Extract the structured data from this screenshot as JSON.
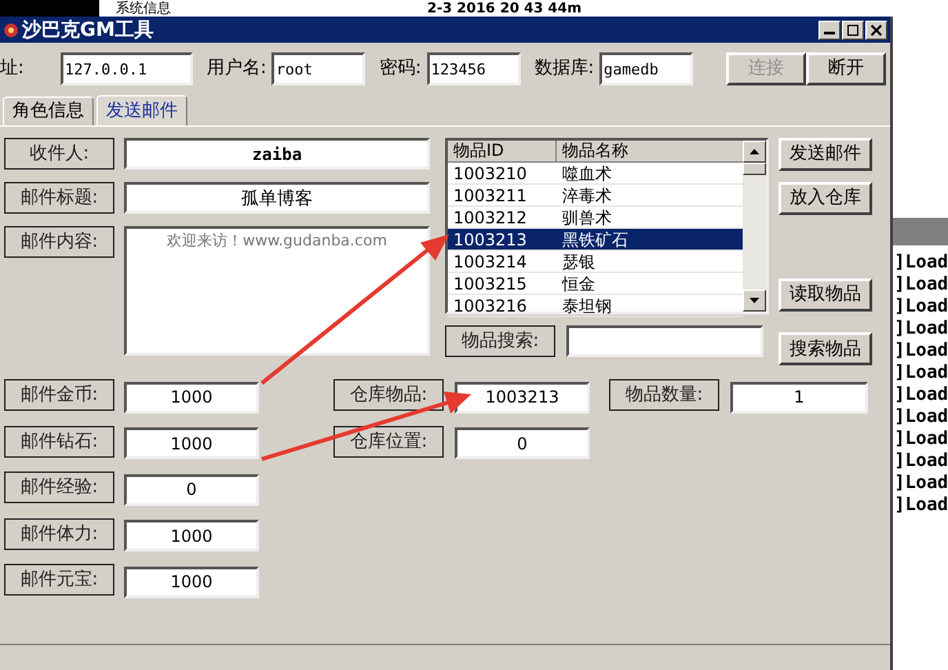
{
  "background": {
    "texts": [
      "系统信息",
      "2-3 2016 20 43 44m"
    ],
    "log_lines": [
      "]Load",
      "]Load",
      "]Load",
      "]Load",
      "]Load",
      "]Load",
      "]Load",
      "]Load",
      "]Load",
      "]Load",
      "]Load",
      "]Load"
    ]
  },
  "window": {
    "title": "沙巴克GM工具"
  },
  "connection": {
    "fields": [
      {
        "label": "址:",
        "value": "127.0.0.1"
      },
      {
        "label": "用户名:",
        "value": "root"
      },
      {
        "label": "密码:",
        "value": "123456"
      },
      {
        "label": "数据库:",
        "value": "gamedb"
      }
    ],
    "buttons": [
      {
        "label": "连接",
        "disabled": true
      },
      {
        "label": "断开",
        "disabled": false
      }
    ]
  },
  "tabs": [
    {
      "label": "角色信息",
      "selected": false
    },
    {
      "label": "发送邮件",
      "selected": true
    }
  ],
  "mail_fields": [
    {
      "label": "收件人:",
      "value": "zaiba",
      "kind": "line"
    },
    {
      "label": "邮件标题:",
      "value": "孤单博客",
      "kind": "line"
    },
    {
      "label": "邮件内容:",
      "value": "欢迎来访！www.gudanba.com",
      "kind": "multiline"
    }
  ],
  "item_list": {
    "columns": [
      "物品ID",
      "物品名称"
    ],
    "rows": [
      {
        "cells": [
          "1003210",
          "噬血术"
        ],
        "selected": false
      },
      {
        "cells": [
          "1003211",
          "淬毒术"
        ],
        "selected": false
      },
      {
        "cells": [
          "1003212",
          "驯兽术"
        ],
        "selected": false
      },
      {
        "cells": [
          "1003213",
          "黑铁矿石"
        ],
        "selected": true
      },
      {
        "cells": [
          "1003214",
          "瑟银"
        ],
        "selected": false
      },
      {
        "cells": [
          "1003215",
          "恒金"
        ],
        "selected": false
      },
      {
        "cells": [
          "1003216",
          "泰坦钢"
        ],
        "selected": false
      }
    ]
  },
  "side_buttons": [
    "发送邮件",
    "放入仓库",
    "读取物品",
    "搜索物品"
  ],
  "search": {
    "label": "物品搜索:"
  },
  "attachment_fields": [
    {
      "label": "邮件金币:",
      "value": "1000"
    },
    {
      "label": "邮件钻石:",
      "value": "1000"
    },
    {
      "label": "邮件经验:",
      "value": "0"
    },
    {
      "label": "邮件体力:",
      "value": "1000"
    },
    {
      "label": "邮件元宝:",
      "value": "1000"
    }
  ],
  "warehouse": [
    {
      "label": "仓库物品:",
      "value": "1003213"
    },
    {
      "label": "物品数量:",
      "value": "1"
    },
    {
      "label": "仓库位置:",
      "value": "0"
    }
  ]
}
